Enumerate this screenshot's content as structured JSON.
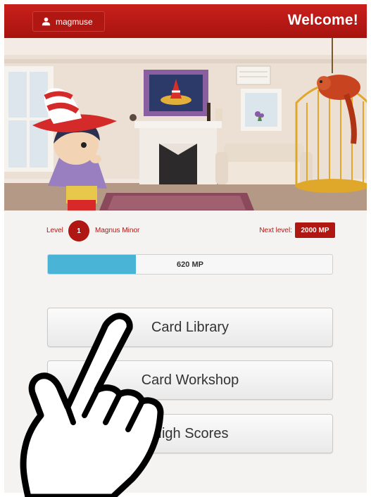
{
  "header": {
    "username": "magmuse",
    "welcome": "Welcome!",
    "user_icon": "user-icon",
    "brand_color": "#b01612"
  },
  "level": {
    "label": "Level",
    "number": "1",
    "rank": "Magnus Minor",
    "next_label": "Next level:",
    "next_value": "2000 MP"
  },
  "progress": {
    "label": "620 MP",
    "fraction": 0.31,
    "color": "#4ab4d6"
  },
  "menu": {
    "library": "Card Library",
    "workshop": "Card Workshop",
    "scores": "High Scores"
  },
  "overlay": {
    "icon": "pointing-hand-icon"
  }
}
